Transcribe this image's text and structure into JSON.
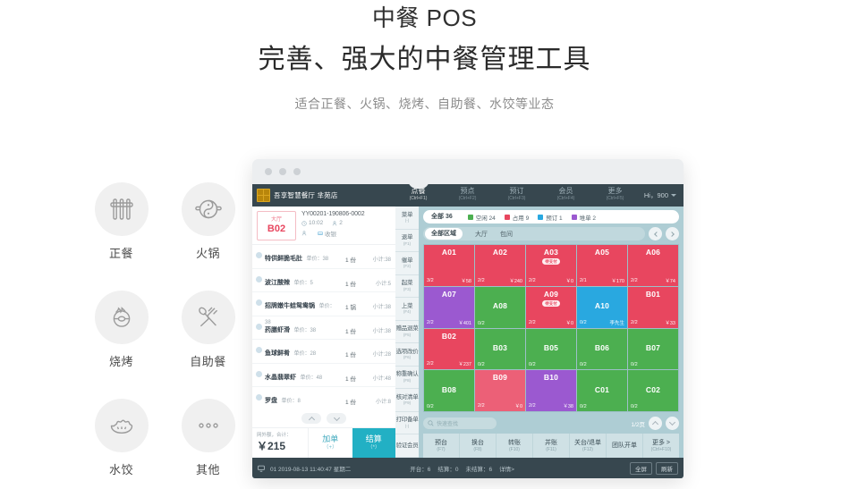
{
  "hero": {
    "title": "中餐 POS",
    "subtitle": "完善、强大的中餐管理工具",
    "tagline": "适合正餐、火锅、烧烤、自助餐、水饺等业态"
  },
  "features": [
    {
      "label": "正餐",
      "icon": "chopsticks-icon"
    },
    {
      "label": "火锅",
      "icon": "hotpot-icon"
    },
    {
      "label": "烧烤",
      "icon": "bbq-icon"
    },
    {
      "label": "自助餐",
      "icon": "fork-spoon-icon"
    },
    {
      "label": "水饺",
      "icon": "dumpling-icon"
    },
    {
      "label": "其他",
      "icon": "ellipsis-icon"
    }
  ],
  "app": {
    "brand": "吾享智慧餐厅 芈苑店",
    "nav": [
      {
        "label": "点餐",
        "key": "(Ctrl+F1)",
        "active": true
      },
      {
        "label": "预点",
        "key": "(Ctrl+F2)",
        "active": false
      },
      {
        "label": "预订",
        "key": "(Ctrl+F3)",
        "active": false
      },
      {
        "label": "会员",
        "key": "(Ctrl+F4)",
        "active": false
      },
      {
        "label": "更多",
        "key": "(Ctrl+F5)",
        "active": false
      }
    ],
    "user": "Hi，900",
    "order": {
      "area": "大厅",
      "table_no": "B02",
      "order_number": "YY00201-190806-0002",
      "time": "10:02",
      "people": "2",
      "waiter": "",
      "receipt": "收银",
      "items": [
        {
          "name": "特供鲜脆毛肚",
          "price": "单价：38",
          "qty": "1 份",
          "subtotal": "小计:38"
        },
        {
          "name": "波江酸辣",
          "price": "单价：5",
          "qty": "1 份",
          "subtotal": "小计:5"
        },
        {
          "name": "招牌嫩牛蛙鸳鸯锅",
          "price": "单价：38",
          "qty": "1 锅",
          "subtotal": "小计:38"
        },
        {
          "name": "药膳虾滑",
          "price": "单价：38",
          "qty": "1 份",
          "subtotal": "小计:38"
        },
        {
          "name": "鱼球鲜肴",
          "price": "单价：28",
          "qty": "1 份",
          "subtotal": "小计:28"
        },
        {
          "name": "水晶翡翠虾",
          "price": "单价：48",
          "qty": "1 份",
          "subtotal": "小计:48"
        },
        {
          "name": "罗盘",
          "price": "单价：8",
          "qty": "1 份",
          "subtotal": "小计:8"
        }
      ],
      "total_label": "网外额，合计：",
      "total_amount": "￥215",
      "add_label": "加单",
      "add_key": "（+）",
      "pay_label": "结算",
      "pay_key": "（*）"
    },
    "side_actions": [
      {
        "label": "菜单",
        "key": "(-)"
      },
      {
        "label": "退单",
        "key": "(F1)"
      },
      {
        "label": "催单",
        "key": "(F2)"
      },
      {
        "label": "起菜",
        "key": "(F3)"
      },
      {
        "label": "上菜",
        "key": "(F4)"
      },
      {
        "label": "赠品退菜",
        "key": "(F5)"
      },
      {
        "label": "选项改价",
        "key": "(F6)"
      },
      {
        "label": "称重确认",
        "key": "(F8)"
      },
      {
        "label": "核对清单",
        "key": "(F9)"
      },
      {
        "label": "打印备单",
        "key": "(-)"
      },
      {
        "label": "验证会员",
        "key": ""
      }
    ],
    "filters": {
      "all_label": "全部 36",
      "states": [
        {
          "label": "空闲 24",
          "color": "#4caf50"
        },
        {
          "label": "占用 9",
          "color": "#e8465f"
        },
        {
          "label": "预订 1",
          "color": "#29a8e0"
        },
        {
          "label": "堆单 2",
          "color": "#9b59d0"
        }
      ]
    },
    "zones": {
      "all_label": "全部区域",
      "items": [
        "大厅",
        "包间"
      ]
    },
    "tables": [
      {
        "name": "A01",
        "state": "occupied",
        "seats": "3/2",
        "amount": "￥58",
        "badge": "",
        "note": ""
      },
      {
        "name": "A02",
        "state": "occupied",
        "seats": "2/2",
        "amount": "￥240",
        "badge": "",
        "note": ""
      },
      {
        "name": "A03",
        "state": "occupied",
        "seats": "2/2",
        "amount": "￥0",
        "badge": "待支付",
        "note": ""
      },
      {
        "name": "A05",
        "state": "occupied",
        "seats": "2/1",
        "amount": "￥170",
        "badge": "",
        "note": ""
      },
      {
        "name": "A06",
        "state": "occupied",
        "seats": "2/2",
        "amount": "￥74",
        "badge": "",
        "note": ""
      },
      {
        "name": "A07",
        "state": "merged",
        "seats": "2/2",
        "amount": "￥401",
        "badge": "",
        "note": ""
      },
      {
        "name": "A08",
        "state": "free",
        "seats": "0/2",
        "amount": "",
        "badge": "",
        "note": ""
      },
      {
        "name": "A09",
        "state": "occupied",
        "seats": "2/2",
        "amount": "￥0",
        "badge": "待支付",
        "note": ""
      },
      {
        "name": "A10",
        "state": "booked",
        "seats": "0/2",
        "amount": "",
        "badge": "",
        "note": "李先生"
      },
      {
        "name": "B01",
        "state": "occupied",
        "seats": "2/2",
        "amount": "￥33",
        "badge": "",
        "note": ""
      },
      {
        "name": "B02",
        "state": "occupied",
        "seats": "2/2",
        "amount": "￥237",
        "badge": "",
        "note": ""
      },
      {
        "name": "B03",
        "state": "free",
        "seats": "0/2",
        "amount": "",
        "badge": "",
        "note": ""
      },
      {
        "name": "B05",
        "state": "free",
        "seats": "0/2",
        "amount": "",
        "badge": "",
        "note": ""
      },
      {
        "name": "B06",
        "state": "free",
        "seats": "0/2",
        "amount": "",
        "badge": "",
        "note": ""
      },
      {
        "name": "B07",
        "state": "free",
        "seats": "0/2",
        "amount": "",
        "badge": "",
        "note": ""
      },
      {
        "name": "B08",
        "state": "free",
        "seats": "0/2",
        "amount": "",
        "badge": "",
        "note": ""
      },
      {
        "name": "B09",
        "state": "occupied",
        "seats": "2/2",
        "amount": "￥0",
        "badge": "",
        "note": ""
      },
      {
        "name": "B10",
        "state": "merged",
        "seats": "2/2",
        "amount": "￥38",
        "badge": "",
        "note": ""
      },
      {
        "name": "C01",
        "state": "free",
        "seats": "0/2",
        "amount": "",
        "badge": "",
        "note": ""
      },
      {
        "name": "C02",
        "state": "free",
        "seats": "0/2",
        "amount": "",
        "badge": "",
        "note": ""
      }
    ],
    "search_placeholder": "快速查找",
    "page_label": "1/2页",
    "bottom_actions": [
      {
        "label": "预台",
        "key": "(F7)"
      },
      {
        "label": "换台",
        "key": "(F8)"
      },
      {
        "label": "转账",
        "key": "(F10)"
      },
      {
        "label": "并账",
        "key": "(F11)"
      },
      {
        "label": "关台/退单",
        "key": "(F12)"
      },
      {
        "label": "团队开单",
        "key": ""
      },
      {
        "label": "更多 >",
        "key": "(Ctrl+F10)"
      }
    ],
    "status": {
      "left": "01 2019-08-13 11:40:47 星期二",
      "open": "开台：6",
      "settled": "结算：0",
      "unsettled": "未结算：6",
      "detail": "详情>",
      "fullscreen": "全屏",
      "refresh": "刷新"
    },
    "colors": {
      "occupied": "#e8465f",
      "free": "#4caf50",
      "booked": "#29a8e0",
      "merged": "#9b59d0",
      "accent": "#22b0c4",
      "navbar": "#37474f"
    }
  }
}
